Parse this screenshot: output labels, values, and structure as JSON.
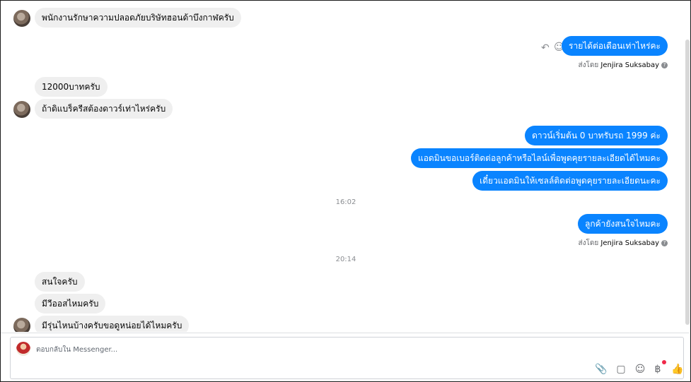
{
  "messages": {
    "m1": "พนักงานรักษาความปลอดภัยบริษัทฮอนด้าบึงกาฬครับ",
    "m2": "รายได้ต่อเดือนเท่าไหร่คะ",
    "m3": "12000บาทครับ",
    "m4": "ถ้าดิแบร็ครีสต้องดาวร์เท่าไหร่ครับ",
    "m5": "ดาวน์เริ่มต้น 0 บาทรับรถ 1999 ค่ะ",
    "m6": "แอดมินขอเบอร์ติดต่อลูกค้าหรือไลน์เพื่อพูดคุยรายละเอียดได้ไหมคะ",
    "m7": "เดี๋ยวแอดมินให้เซลล์ติดต่อพูดคุยรายละเอียดนะคะ",
    "m8": "ลูกค้ายังสนใจไหมคะ",
    "m9": "สนใจครับ",
    "m10": "มีวีออสไหมครับ",
    "m11": "มีรุ่นไหนบ้างครับขอดูหน่อยได้ไหมครับ"
  },
  "timestamps": {
    "t1": "16:02",
    "t2": "20:14"
  },
  "sent_by": {
    "prefix": "ส่งโดย",
    "name": "Jenjira Suksabay",
    "help": "?"
  },
  "composer": {
    "placeholder": "ตอบกลับใน Messenger..."
  },
  "icons": {
    "reply": "↶",
    "emoji": "☺",
    "attach": "📎",
    "sticker": "▢",
    "emoji_tool": "☺",
    "baht": "฿",
    "like": "👍"
  },
  "colors": {
    "outgoing": "#0a84ff",
    "incoming": "#efefef",
    "badge_dot": "#f02849"
  }
}
